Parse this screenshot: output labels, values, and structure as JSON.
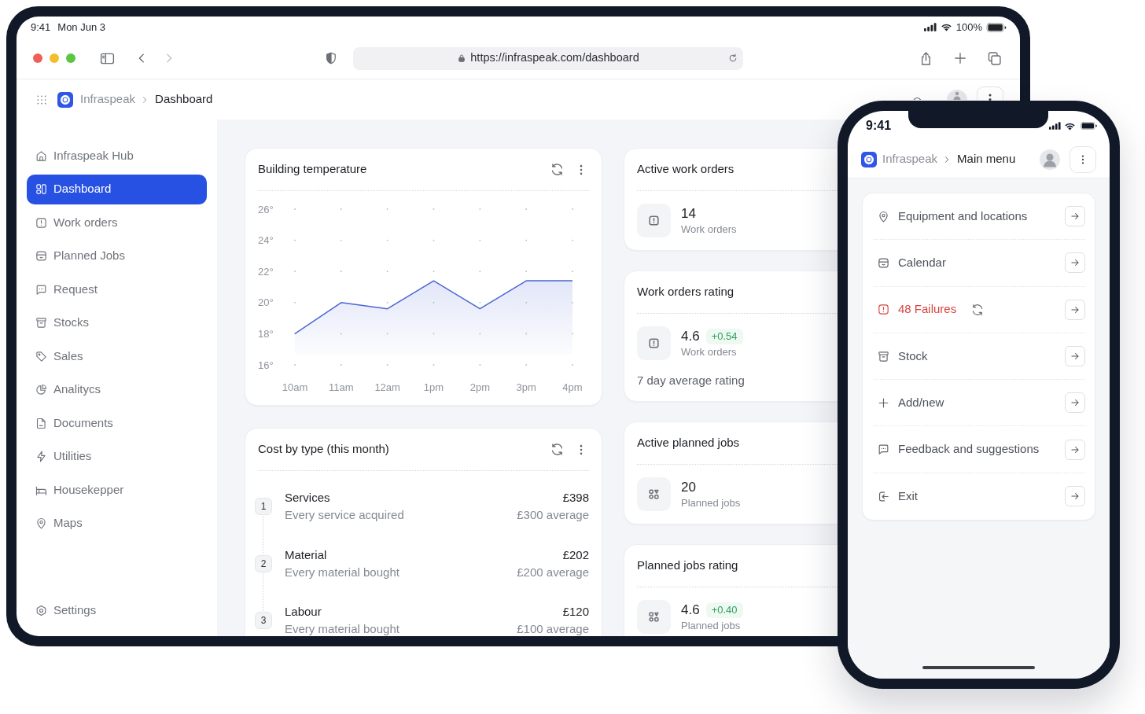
{
  "tablet": {
    "status_bar": {
      "time": "9:41",
      "date": "Mon Jun 3",
      "battery": "100%"
    },
    "browser": {
      "url": "https://infraspeak.com/dashboard",
      "back_disabled": false,
      "forward_disabled": true
    },
    "breadcrumb": {
      "app": "Infraspeak",
      "page": "Dashboard"
    },
    "sidebar": {
      "items": [
        {
          "label": "Infraspeak Hub",
          "selected": false
        },
        {
          "label": "Dashboard",
          "selected": true
        },
        {
          "label": "Work orders",
          "selected": false
        },
        {
          "label": "Planned Jobs",
          "selected": false
        },
        {
          "label": "Request",
          "selected": false
        },
        {
          "label": "Stocks",
          "selected": false
        },
        {
          "label": "Sales",
          "selected": false
        },
        {
          "label": "Analitycs",
          "selected": false
        },
        {
          "label": "Documents",
          "selected": false
        },
        {
          "label": "Utilities",
          "selected": false
        },
        {
          "label": "Housekepper",
          "selected": false
        },
        {
          "label": "Maps",
          "selected": false
        }
      ],
      "footer_items": [
        {
          "label": "Settings",
          "selected": false
        }
      ]
    },
    "dashboard": {
      "temperature_card": {
        "title": "Building temperature",
        "chart_data": {
          "type": "area",
          "categories": [
            "10am",
            "11am",
            "12am",
            "1pm",
            "2pm",
            "3pm",
            "4pm"
          ],
          "series": [
            {
              "color": "#4a66d4",
              "values": [
                18,
                20,
                19.6,
                21.4,
                19.6,
                21.4,
                21.4
              ]
            }
          ],
          "ylim": [
            16,
            26
          ],
          "yticks": [
            {
              "value": 26,
              "label": "26°"
            },
            {
              "value": 24,
              "label": "24°"
            },
            {
              "value": 22,
              "label": "22°"
            },
            {
              "value": 20,
              "label": "20°"
            },
            {
              "value": 18,
              "label": "18°"
            },
            {
              "value": 16,
              "label": "16°"
            }
          ]
        }
      },
      "cost_card": {
        "title": "Cost by type (this month)",
        "rows": [
          {
            "rank": "1",
            "name": "Services",
            "description": "Every service acquired",
            "amount": "£398",
            "average": "£300 average"
          },
          {
            "rank": "2",
            "name": "Material",
            "description": "Every material bought",
            "amount": "£202",
            "average": "£200 average"
          },
          {
            "rank": "3",
            "name": "Labour",
            "description": "Every material bought",
            "amount": "£120",
            "average": "£100 average"
          }
        ]
      },
      "work_orders": {
        "active": {
          "title": "Active work orders",
          "value": "14",
          "unit": "Work orders"
        },
        "rating": {
          "title": "Work orders rating",
          "value": "4.6",
          "change": "+0.54",
          "unit": "Work orders",
          "footer": "7 day average rating"
        }
      },
      "planned_jobs": {
        "active": {
          "title": "Active planned jobs",
          "value": "20",
          "unit": "Planned jobs"
        },
        "rating": {
          "title": "Planned jobs rating",
          "value": "4.6",
          "change": "+0.40",
          "unit": "Planned jobs"
        }
      }
    }
  },
  "phone": {
    "status_bar": {
      "time": "9:41"
    },
    "breadcrumb": {
      "app": "Infraspeak",
      "page": "Main menu"
    },
    "menu": [
      {
        "label": "Equipment and locations",
        "alert": false
      },
      {
        "label": "Calendar",
        "alert": false
      },
      {
        "label": "48 Failures",
        "alert": true
      },
      {
        "label": "Stock",
        "alert": false
      },
      {
        "label": "Add/new",
        "alert": false
      },
      {
        "label": "Feedback and suggestions",
        "alert": false
      },
      {
        "label": "Exit",
        "alert": false
      }
    ]
  }
}
